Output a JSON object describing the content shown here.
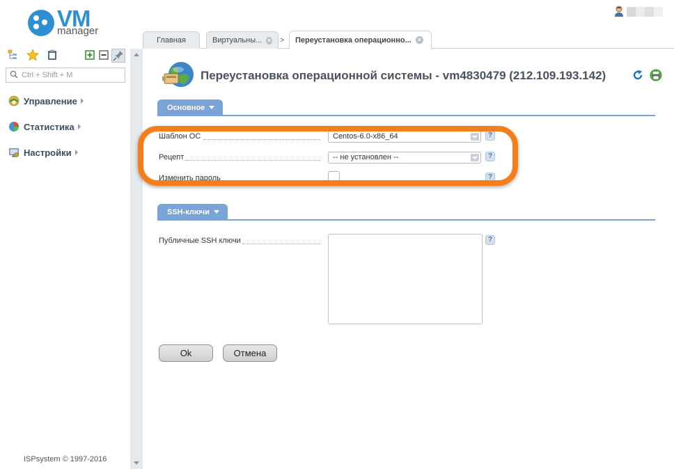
{
  "brand": {
    "logo_main": "VM",
    "logo_sub": "manager",
    "color": "#2f8fd3"
  },
  "sidebar": {
    "toolbar_icons": [
      "tree-icon",
      "star-icon",
      "clipboard-icon",
      "expand-all-icon",
      "collapse-all-icon",
      "pin-icon"
    ],
    "search_placeholder": "Ctrl + Shift + M",
    "items": [
      {
        "label": "Управление",
        "icon": "management-icon"
      },
      {
        "label": "Статистика",
        "icon": "statistics-icon"
      },
      {
        "label": "Настройки",
        "icon": "settings-icon"
      }
    ],
    "copyright": "ISPsystem © 1997-2016"
  },
  "tabs": [
    {
      "label": "Главная",
      "closable": false
    },
    {
      "label": "Виртуальны...",
      "closable": true
    },
    {
      "label": "Переустановка операционно...",
      "closable": true,
      "active": true
    }
  ],
  "page": {
    "title": "Переустановка операционной системы - vm4830479 (212.109.193.142)"
  },
  "sections": {
    "main": {
      "label": "Основное",
      "fields": {
        "os_template": {
          "label": "Шаблон ОС",
          "value": "Centos-6.0-x86_64"
        },
        "recipe": {
          "label": "Рецепт",
          "value": "-- не установлен --"
        },
        "change_password": {
          "label": "Изменить пароль",
          "checked": false
        }
      }
    },
    "ssh": {
      "label": "SSH-ключи",
      "fields": {
        "public_keys": {
          "label": "Публичные SSH ключи",
          "value": ""
        }
      }
    }
  },
  "help_symbol": "?",
  "actions": {
    "ok": "Ok",
    "cancel": "Отмена"
  },
  "colors": {
    "accent": "#7aa3d6",
    "highlight": "#f57e1a"
  }
}
